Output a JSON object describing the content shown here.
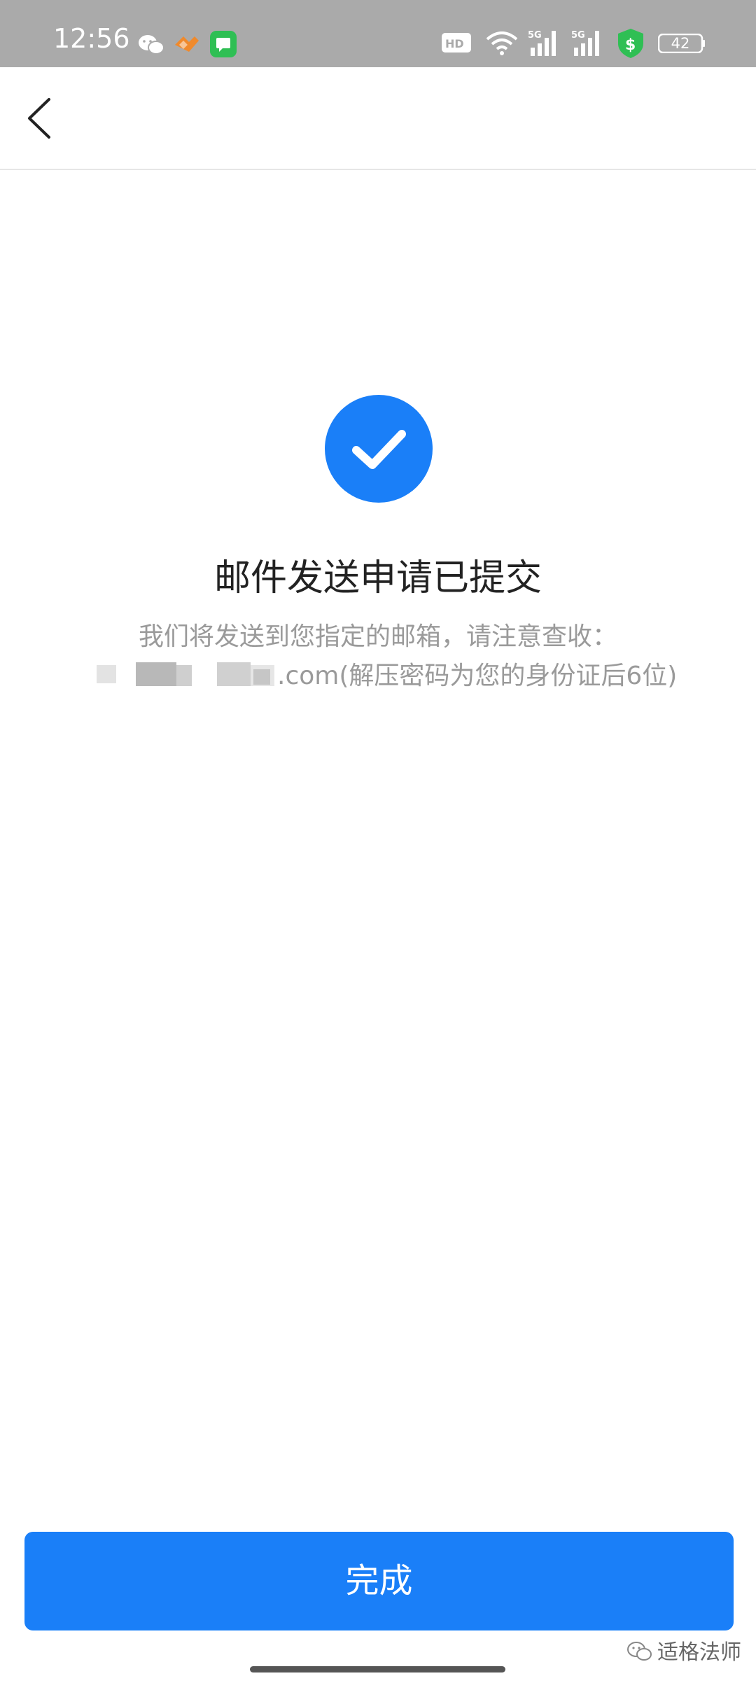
{
  "status_bar": {
    "time": "12:56",
    "battery": "42",
    "icons": [
      "wechat-icon",
      "orange-app-icon",
      "message-app-icon",
      "hd-voice-icon",
      "wifi-icon",
      "signal-5g-icon",
      "signal-5g-icon",
      "security-shield-icon",
      "battery-icon"
    ],
    "colors": {
      "background": "#aaaaaa",
      "shield": "#2fbf54",
      "message_app": "#2fbf54",
      "orange_app": "#f08a2c"
    }
  },
  "nav": {
    "back_icon": "chevron-left-icon"
  },
  "result": {
    "icon": "check-circle-icon",
    "icon_color": "#1a7ff8",
    "title": "邮件发送申请已提交",
    "description_line1": "我们将发送到您指定的邮箱，请注意查收：",
    "email_suffix_and_note": ".com(解压密码为您的身份证后6位)"
  },
  "footer": {
    "done_label": "完成",
    "button_color": "#1a7ff8"
  },
  "watermark": {
    "text": "适格法师",
    "icon": "wechat-icon"
  }
}
